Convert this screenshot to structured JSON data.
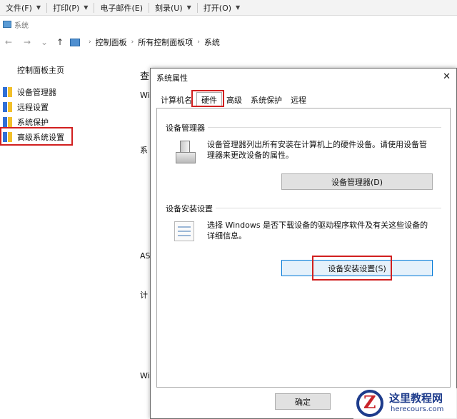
{
  "menubar": {
    "items": [
      {
        "label": "文件(F)"
      },
      {
        "label": "打印(P)"
      },
      {
        "label": "电子邮件(E)"
      },
      {
        "label": "刻录(U)"
      },
      {
        "label": "打开(O)"
      }
    ],
    "caret": "▼"
  },
  "window": {
    "title": "系统"
  },
  "nav": {
    "back": "←",
    "forward": "→",
    "recent": "⌄",
    "up": "↑",
    "breadcrumb": [
      "控制面板",
      "所有控制面板项",
      "系统"
    ],
    "sep": "›"
  },
  "left_pane": {
    "home": "控制面板主页",
    "links": [
      "设备管理器",
      "远程设置",
      "系统保护",
      "高级系统设置"
    ]
  },
  "main_fragments": {
    "f1": "查",
    "f2": "Wi",
    "f3": "系",
    "f4": "AS",
    "f5": "计",
    "f6": "Wi"
  },
  "dialog": {
    "title": "系统属性",
    "close": "✕",
    "tabs": [
      "计算机名",
      "硬件",
      "高级",
      "系统保护",
      "远程"
    ],
    "active_tab": "硬件",
    "device_manager": {
      "group": "设备管理器",
      "desc": "设备管理器列出所有安装在计算机上的硬件设备。请使用设备管理器来更改设备的属性。",
      "button": "设备管理器(D)"
    },
    "device_install": {
      "group": "设备安装设置",
      "desc": "选择 Windows 是否下载设备的驱动程序软件及有关这些设备的详细信息。",
      "button": "设备安装设置(S)"
    },
    "ok": "确定"
  },
  "watermark": {
    "name": "这里教程网",
    "url": "herecours.com"
  },
  "colors": {
    "highlight": "#d11f1f",
    "accent": "#0078d7",
    "watermark": "#1e3c8c"
  }
}
